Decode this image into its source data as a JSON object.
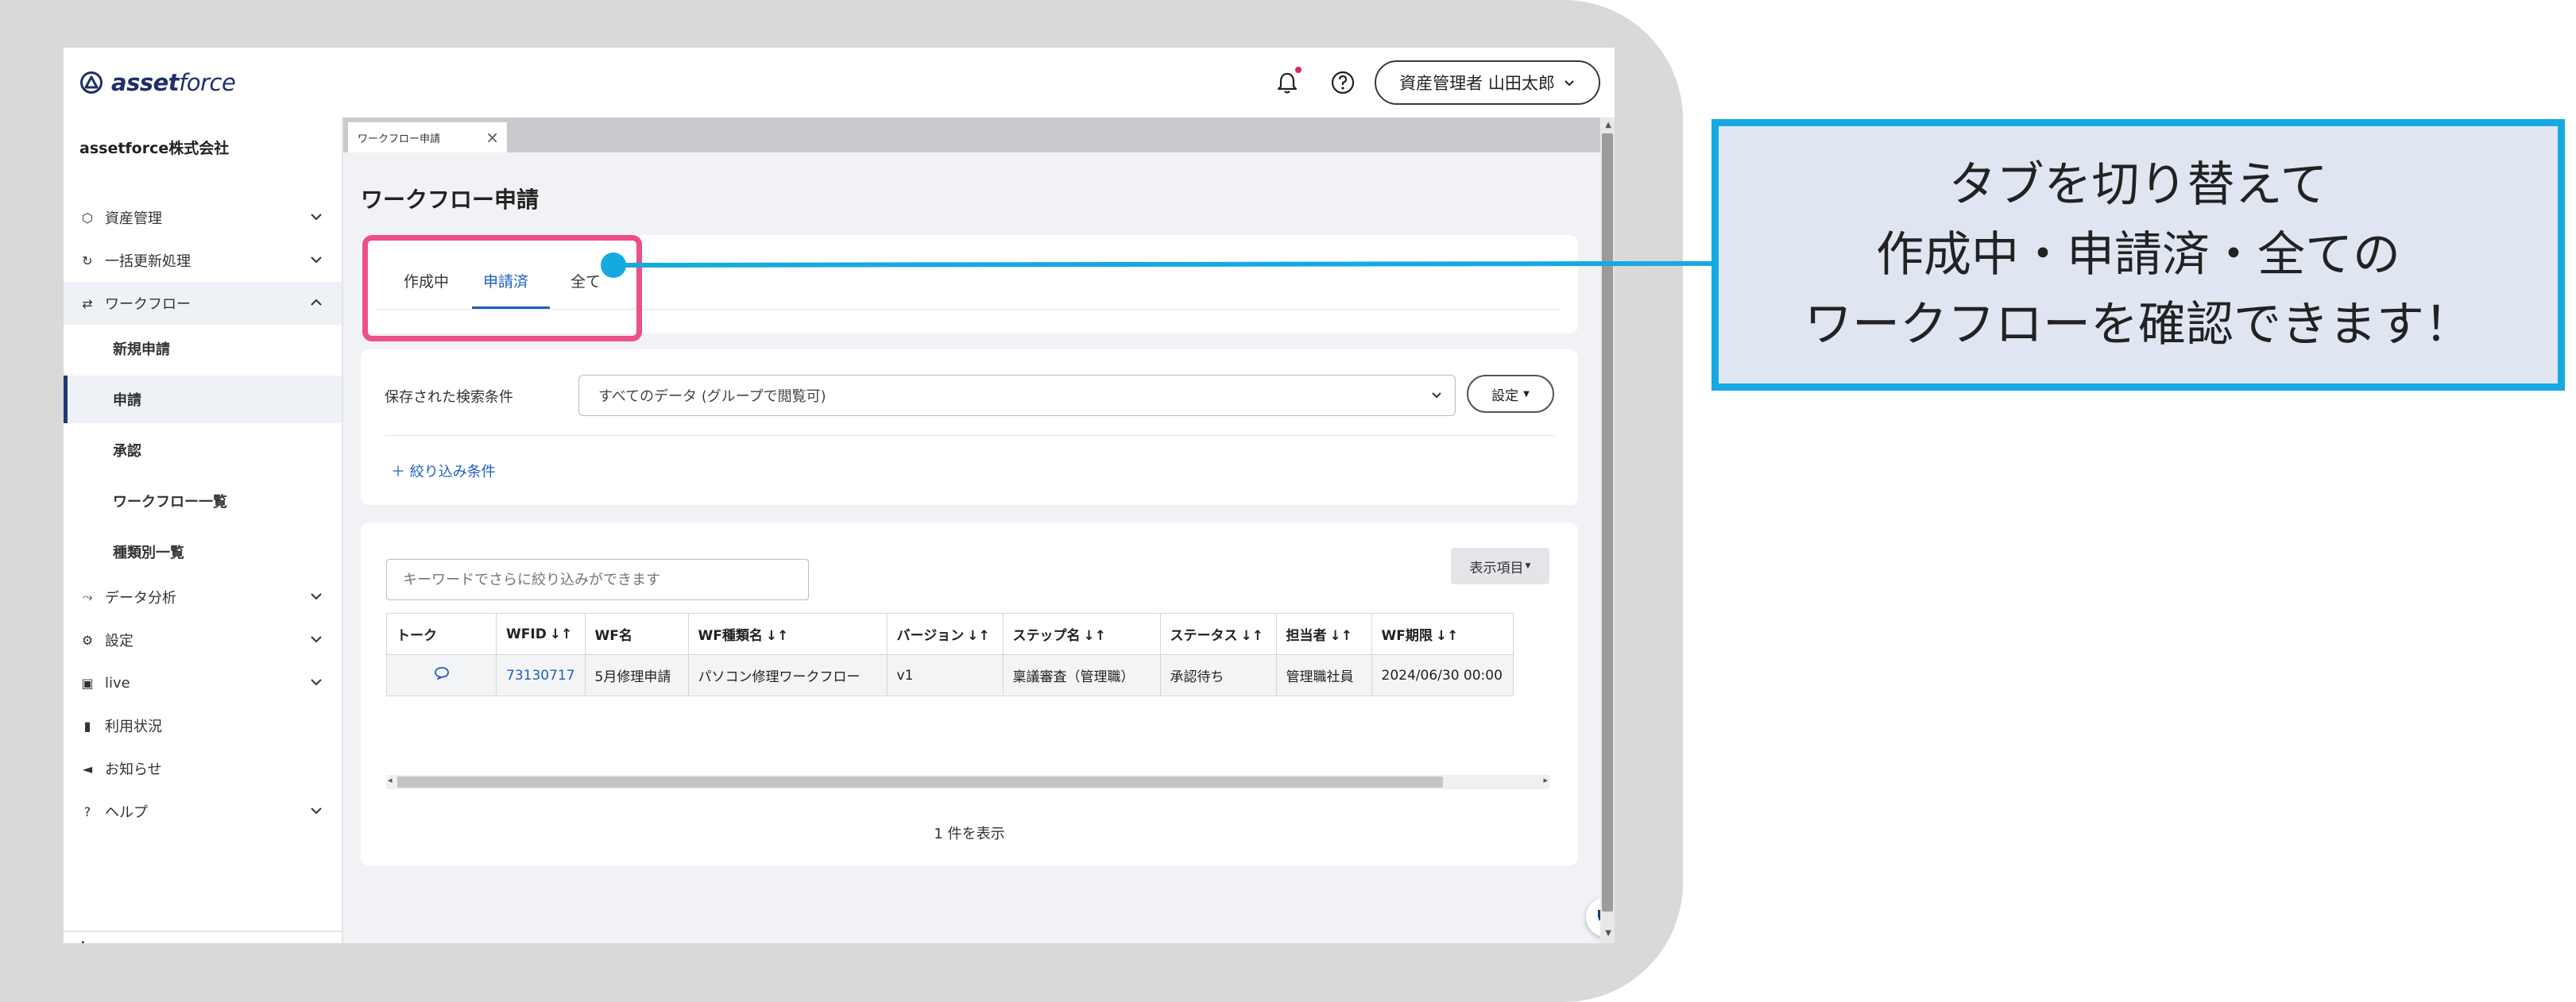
{
  "header": {
    "logo_text_bold": "asset",
    "logo_text_light": "force",
    "user_button_label": "資産管理者 山田太郎"
  },
  "sidebar": {
    "company": "assetforce株式会社",
    "items": [
      {
        "label": "資産管理",
        "icon": "cube-icon"
      },
      {
        "label": "一括更新処理",
        "icon": "refresh-icon"
      },
      {
        "label": "ワークフロー",
        "icon": "workflow-icon"
      },
      {
        "label": "データ分析",
        "icon": "chart-icon"
      },
      {
        "label": "設定",
        "icon": "gear-icon"
      },
      {
        "label": "live",
        "icon": "monitor-icon"
      },
      {
        "label": "利用状況",
        "icon": "bar-chart-icon"
      },
      {
        "label": "お知らせ",
        "icon": "megaphone-icon"
      },
      {
        "label": "ヘルプ",
        "icon": "help-circle-icon"
      }
    ],
    "workflow_sub": [
      {
        "label": "新規申請"
      },
      {
        "label": "申請"
      },
      {
        "label": "承認"
      },
      {
        "label": "ワークフロー一覧"
      },
      {
        "label": "種類別一覧"
      }
    ],
    "collapse_icon": "collapse-left-icon"
  },
  "main": {
    "doc_tab_label": "ワークフロー申請",
    "page_title": "ワークフロー申請",
    "status_tabs": [
      {
        "label": "作成中"
      },
      {
        "label": "申請済",
        "selected": true
      },
      {
        "label": "全て"
      }
    ],
    "saved_search_label": "保存された検索条件",
    "saved_search_value": "すべてのデータ (グループで閲覧可)",
    "settings_button": "設定",
    "filter_link": "＋ 絞り込み条件",
    "keyword_placeholder": "キーワードでさらに絞り込みができます",
    "columns_button": "表示項目",
    "table": {
      "headers": [
        "トーク",
        "WFID",
        "WF名",
        "WF種類名",
        "バージョン",
        "ステップ名",
        "ステータス",
        "担当者",
        "WF期限"
      ],
      "rows": [
        [
          "",
          "73130717",
          "5月修理申請",
          "パソコン修理ワークフロー",
          "v1",
          "稟議審査（管理職）",
          "承認待ち",
          "管理職社員",
          "2024/06/30 00:00"
        ]
      ]
    },
    "count_text": "1 件を表示"
  },
  "annotation": {
    "lines": [
      "タブを切り替えて",
      "作成中・申請済・全ての",
      "ワークフローを確認できます！"
    ],
    "highlight_color": "#ec4f8b",
    "callout_color": "#16a9e1"
  }
}
